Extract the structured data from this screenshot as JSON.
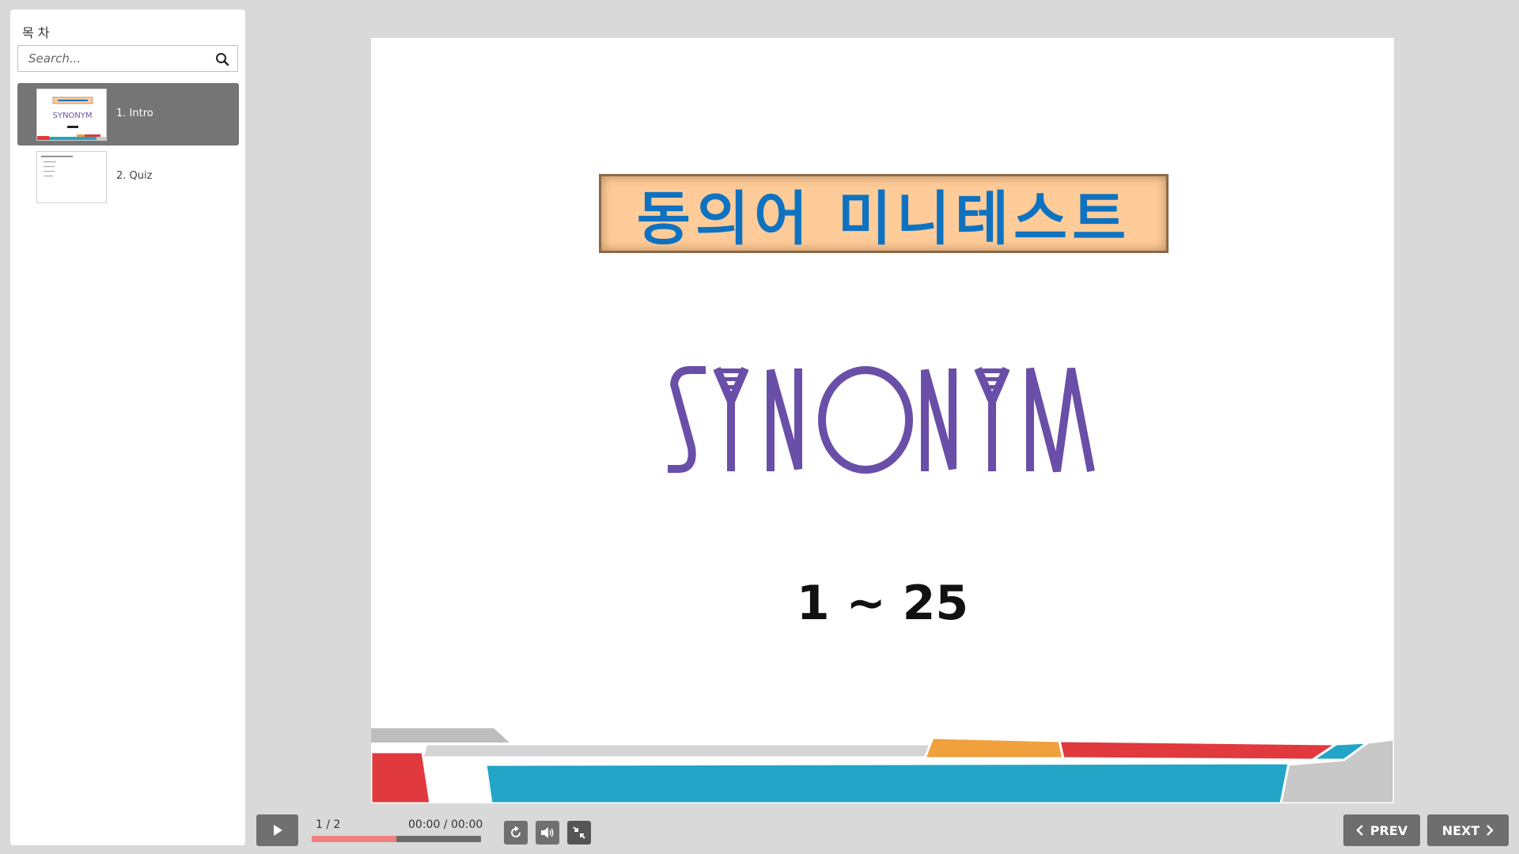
{
  "sidebar": {
    "title": "목 차",
    "search": {
      "placeholder": "Search...",
      "value": ""
    },
    "items": [
      {
        "label": "1. Intro",
        "active": true
      },
      {
        "label": "2. Quiz",
        "active": false
      }
    ]
  },
  "slide": {
    "title": "동의어 미니테스트",
    "logo_text": "SYNONYM",
    "range": "1 ~ 25"
  },
  "controls": {
    "slide_counter": "1 / 2",
    "time": "00:00 / 00:00",
    "progress": 0.5,
    "prev_label": "PREV",
    "next_label": "NEXT"
  },
  "colors": {
    "banner_bg": "#ffcc99",
    "title_blue": "#0f72c0",
    "logo_purple": "#6a4fa8",
    "progress_fill": "#f08080",
    "control_grey": "#707070"
  },
  "icons": [
    "search-icon",
    "play-icon",
    "replay-icon",
    "volume-icon",
    "collapse-icon",
    "chevron-left-icon",
    "chevron-right-icon"
  ]
}
